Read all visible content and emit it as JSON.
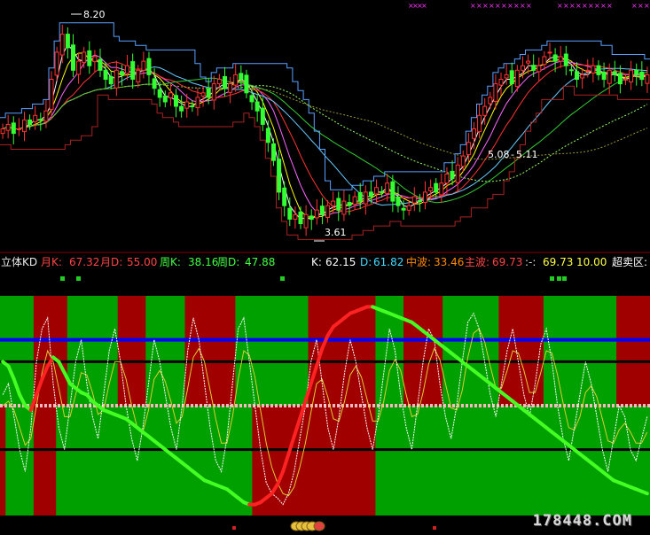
{
  "colors": {
    "background": "#000000",
    "up_candle": "#ff3333",
    "down_candle": "#33ff33",
    "panel_red": "#a00000",
    "panel_green": "#00a000",
    "line_blue": "#0000ff",
    "line_pink": "#ffb6c1",
    "line_black": "#000000",
    "marker_magenta": "#ff33ff"
  },
  "info_bar": {
    "indicator_name": "立体KD",
    "month_k_label": "月K:",
    "month_k_value": "67.32",
    "month_d_label": "月D:",
    "month_d_value": "55.00",
    "week_k_label": "周K:",
    "week_k_value": "38.16",
    "week_d_label": "周D:",
    "week_d_value": "47.88",
    "k_label": "K:",
    "k_value": "62.15",
    "d_label": "D:",
    "d_value": "61.82",
    "mid_wave_label": "中波:",
    "mid_wave_value": "33.46",
    "main_wave_label": "主波:",
    "main_wave_value": "69.73",
    "extra_label": ":-:",
    "extra_value": "69.73",
    "extra_value2": "10.00",
    "oversold_label": "超卖区:"
  },
  "watermark": "178448.COM",
  "chart_data": [
    {
      "type": "candlestick",
      "annotations": [
        "8.20",
        "3.61",
        "5.08",
        "5.11"
      ],
      "high_price": 8.2,
      "low_price": 3.61,
      "x_range": [
        0,
        120
      ],
      "y_range": [
        3.3,
        8.6
      ],
      "close": [
        5.9,
        6.0,
        5.8,
        5.9,
        6.1,
        6.0,
        6.2,
        6.1,
        6.3,
        7.0,
        7.6,
        8.0,
        7.7,
        7.2,
        7.4,
        7.6,
        7.3,
        7.5,
        7.2,
        7.0,
        6.9,
        7.2,
        7.1,
        7.3,
        7.0,
        7.2,
        7.4,
        7.1,
        6.8,
        6.6,
        6.5,
        6.7,
        6.4,
        6.3,
        6.5,
        6.4,
        6.6,
        6.7,
        6.6,
        6.9,
        7.0,
        6.8,
        6.9,
        7.1,
        7.0,
        6.7,
        6.5,
        6.3,
        6.0,
        5.6,
        5.2,
        4.5,
        4.2,
        3.9,
        4.0,
        3.8,
        4.0,
        3.9,
        4.1,
        4.0,
        4.2,
        4.3,
        4.1,
        4.3,
        4.2,
        4.4,
        4.3,
        4.5,
        4.4,
        4.6,
        4.5,
        4.7,
        4.3,
        4.2,
        4.1,
        4.2,
        4.4,
        4.3,
        4.5,
        4.6,
        4.5,
        4.7,
        4.9,
        4.8,
        5.1,
        5.3,
        5.6,
        5.9,
        6.2,
        6.4,
        6.6,
        6.9,
        7.0,
        7.1,
        6.9,
        7.2,
        7.3,
        7.4,
        7.2,
        7.3,
        7.5,
        7.6,
        7.4,
        7.5,
        7.3,
        7.2,
        7.0,
        7.1,
        7.2,
        7.3,
        7.1,
        7.0,
        7.2,
        7.1,
        6.9,
        7.0,
        7.2,
        7.1,
        7.0,
        7.1
      ]
    },
    {
      "type": "area",
      "title": "立体KD",
      "y_range": [
        0,
        100
      ],
      "levels": [
        80,
        70,
        50,
        30
      ],
      "k_line": [
        55,
        60,
        45,
        30,
        20,
        40,
        70,
        85,
        90,
        60,
        40,
        30,
        50,
        70,
        80,
        60,
        45,
        35,
        55,
        75,
        85,
        70,
        50,
        35,
        25,
        40,
        60,
        80,
        70,
        55,
        40,
        30,
        50,
        75,
        90,
        80,
        60,
        40,
        25,
        20,
        35,
        60,
        85,
        90,
        70,
        50,
        30,
        15,
        10,
        8,
        5,
        10,
        20,
        35,
        50,
        70,
        80,
        60,
        40,
        30,
        45,
        65,
        80,
        70,
        55,
        40,
        30,
        45,
        65,
        85,
        75,
        55,
        40,
        30,
        50,
        70,
        85,
        80,
        60,
        45,
        35,
        50,
        70,
        88,
        92,
        85,
        70,
        55,
        45,
        60,
        75,
        85,
        70,
        55,
        45,
        60,
        78,
        85,
        70,
        50,
        35,
        25,
        40,
        55,
        70,
        60,
        45,
        30,
        20,
        35,
        50,
        45,
        30,
        25,
        35,
        45
      ],
      "d_line": [
        50,
        52,
        48,
        40,
        32,
        35,
        50,
        65,
        75,
        70,
        58,
        45,
        45,
        55,
        65,
        64,
        56,
        46,
        48,
        60,
        70,
        70,
        62,
        50,
        40,
        38,
        48,
        62,
        66,
        61,
        52,
        42,
        45,
        58,
        72,
        76,
        70,
        57,
        44,
        33,
        33,
        45,
        62,
        75,
        73,
        63,
        48,
        33,
        22,
        15,
        10,
        9,
        13,
        22,
        33,
        47,
        60,
        62,
        54,
        44,
        43,
        52,
        64,
        68,
        63,
        53,
        43,
        43,
        52,
        66,
        71,
        66,
        55,
        45,
        46,
        56,
        69,
        76,
        71,
        60,
        49,
        48,
        57,
        72,
        83,
        85,
        79,
        68,
        58,
        58,
        66,
        75,
        74,
        66,
        56,
        56,
        65,
        75,
        74,
        64,
        51,
        40,
        39,
        45,
        56,
        59,
        54,
        44,
        34,
        33,
        39,
        42,
        38,
        33,
        33,
        38
      ],
      "main_wave": [
        70,
        68,
        62,
        55,
        50,
        48,
        55,
        62,
        68,
        72,
        70,
        65,
        60,
        58,
        56,
        55,
        52,
        50,
        48,
        47,
        46,
        45,
        44,
        42,
        40,
        38,
        36,
        34,
        32,
        30,
        28,
        26,
        24,
        22,
        20,
        18,
        16,
        15,
        14,
        13,
        12,
        10,
        8,
        6,
        5,
        5,
        6,
        8,
        10,
        14,
        20,
        28,
        36,
        44,
        52,
        60,
        68,
        76,
        82,
        86,
        88,
        90,
        92,
        93,
        94,
        95,
        95,
        94,
        93,
        92,
        91,
        90,
        89,
        88,
        86,
        84,
        82,
        80,
        78,
        76,
        74,
        72,
        70,
        68,
        66,
        64,
        62,
        60,
        58,
        56,
        54,
        52,
        50,
        48,
        46,
        44,
        42,
        40,
        38,
        36,
        34,
        32,
        30,
        28,
        26,
        24,
        22,
        20,
        18,
        16,
        15,
        14,
        13,
        12,
        11,
        10
      ],
      "trend_segments": [
        1,
        1,
        1,
        1,
        1,
        1,
        0,
        0,
        0,
        0,
        0,
        0,
        1,
        1,
        1,
        1,
        1,
        1,
        1,
        1,
        1,
        0,
        0,
        0,
        0,
        0,
        1,
        1,
        1,
        1,
        1,
        1,
        1,
        0,
        0,
        0,
        0,
        0,
        0,
        0,
        0,
        0,
        1,
        1,
        1,
        1,
        1,
        1,
        1,
        1,
        1,
        1,
        1,
        1,
        1,
        0,
        0,
        0,
        0,
        0,
        0,
        0,
        0,
        0,
        0,
        0,
        0,
        1,
        1,
        1,
        1,
        1,
        0,
        0,
        0,
        0,
        0,
        0,
        0,
        1,
        1,
        1,
        1,
        1,
        1,
        1,
        1,
        1,
        1,
        0,
        0,
        0,
        0,
        0,
        0,
        0,
        0,
        1,
        1,
        1,
        1,
        1,
        1,
        1,
        1,
        1,
        1,
        1,
        1,
        1,
        0,
        0,
        0,
        0,
        0,
        0,
        0,
        0,
        0,
        0
      ]
    }
  ]
}
